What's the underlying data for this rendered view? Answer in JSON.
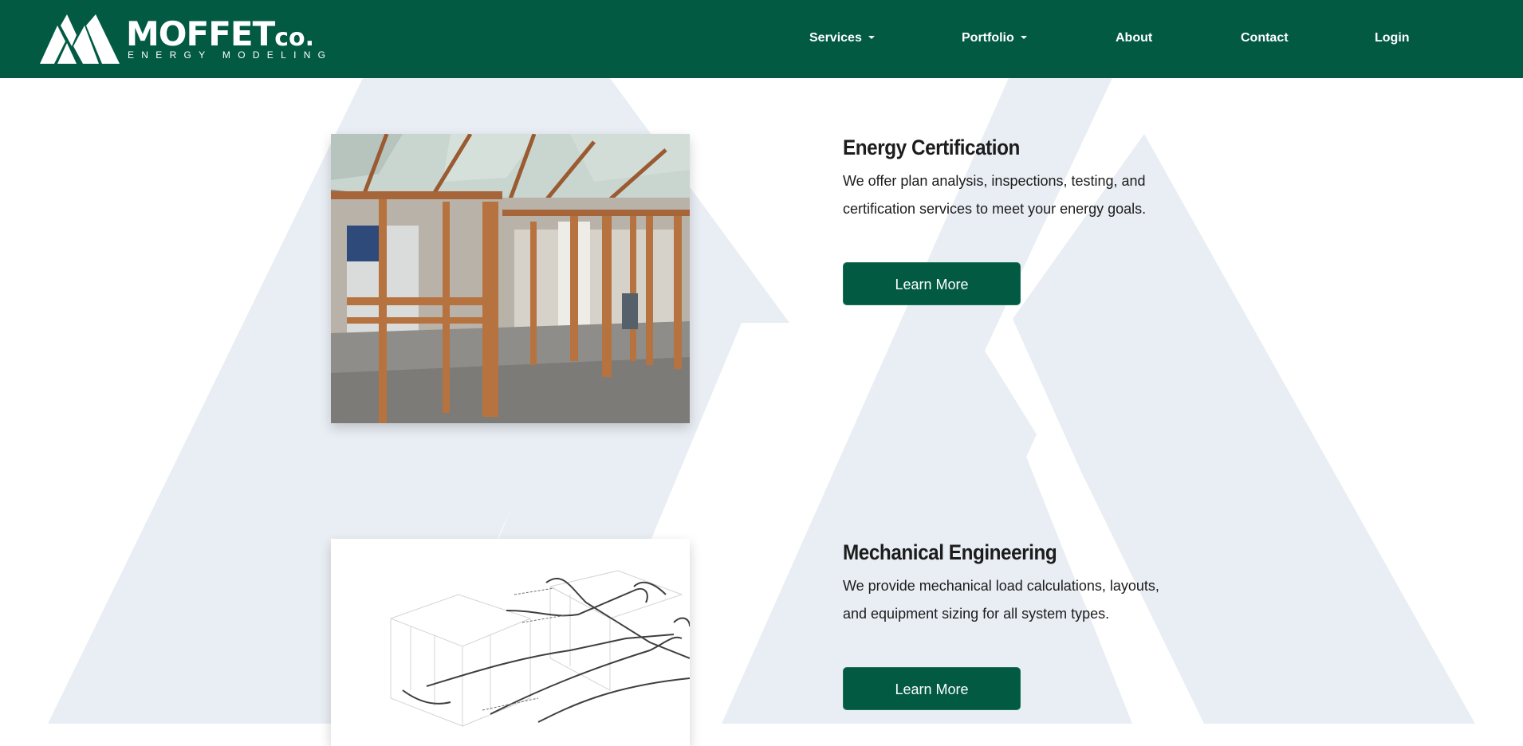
{
  "colors": {
    "brand_green": "#025a43",
    "watermark": "#e9eef4"
  },
  "header": {
    "logo_name": "MOFFET",
    "logo_suffix": "co.",
    "logo_tagline": "ENERGY MODELING",
    "logo_icon": "mountain-logo-icon",
    "nav": {
      "services": "Services",
      "portfolio": "Portfolio",
      "about": "About",
      "contact": "Contact",
      "login": "Login"
    }
  },
  "services": [
    {
      "title": "Energy Certification",
      "description": "We offer plan analysis, inspections, testing, and certification services to meet your energy goals.",
      "button": "Learn More",
      "image": "framed-interior-photo"
    },
    {
      "title": "Mechanical Engineering",
      "description": "We provide mechanical load calculations, layouts, and equipment sizing for all system types.",
      "button": "Learn More",
      "image": "duct-layout-drawing"
    }
  ]
}
